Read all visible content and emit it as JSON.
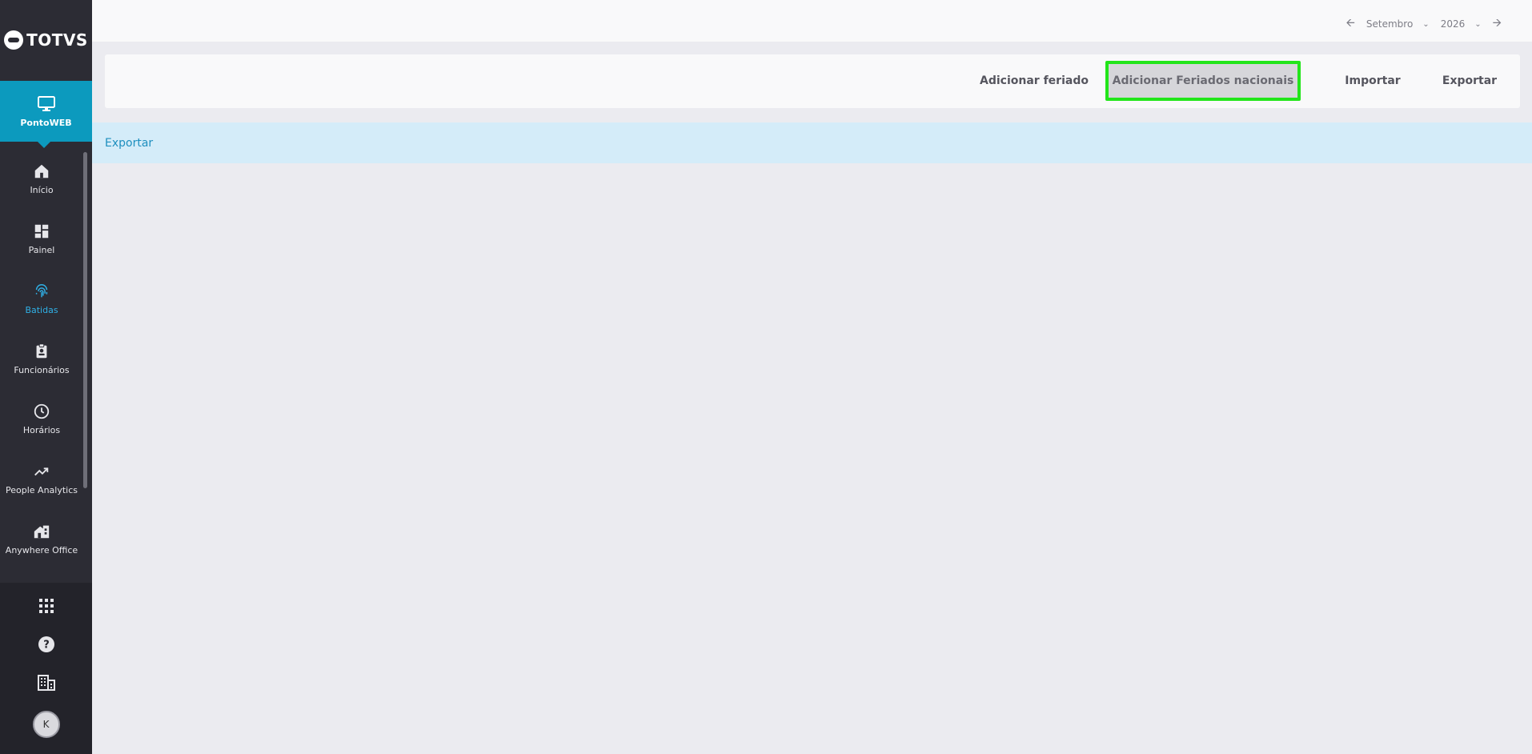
{
  "app": {
    "logo_text": "TOTVS",
    "product_label": "PontoWEB"
  },
  "sidebar": {
    "items": [
      {
        "label": "Início",
        "icon": "home-icon",
        "active": false
      },
      {
        "label": "Painel",
        "icon": "dashboard-icon",
        "active": false
      },
      {
        "label": "Batidas",
        "icon": "fingerprint-icon",
        "active": true
      },
      {
        "label": "Funcionários",
        "icon": "badge-icon",
        "active": false
      },
      {
        "label": "Horários",
        "icon": "clock-icon",
        "active": false
      },
      {
        "label": "People Analytics",
        "icon": "trending-up-icon",
        "active": false
      },
      {
        "label": "Anywhere Office",
        "icon": "home-office-icon",
        "active": false
      }
    ],
    "bottom": {
      "apps_icon": "apps-grid-icon",
      "help_icon": "help-icon",
      "company_icon": "building-icon",
      "avatar_initial": "K"
    }
  },
  "topbar": {
    "month": "Setembro",
    "year": "2026"
  },
  "toolbar": {
    "add_holiday": "Adicionar feriado",
    "add_national_holidays": "Adicionar Feriados nacionais",
    "import": "Importar",
    "export": "Exportar"
  },
  "banner": {
    "link": "Exportar"
  },
  "colors": {
    "sidebar_bg": "#2c2c34",
    "product_bg": "#0c9abe",
    "active_nav": "#2fb0e6",
    "highlight_border": "#22e51a",
    "banner_bg": "#d4ecf9",
    "banner_link": "#1e8fbf"
  }
}
